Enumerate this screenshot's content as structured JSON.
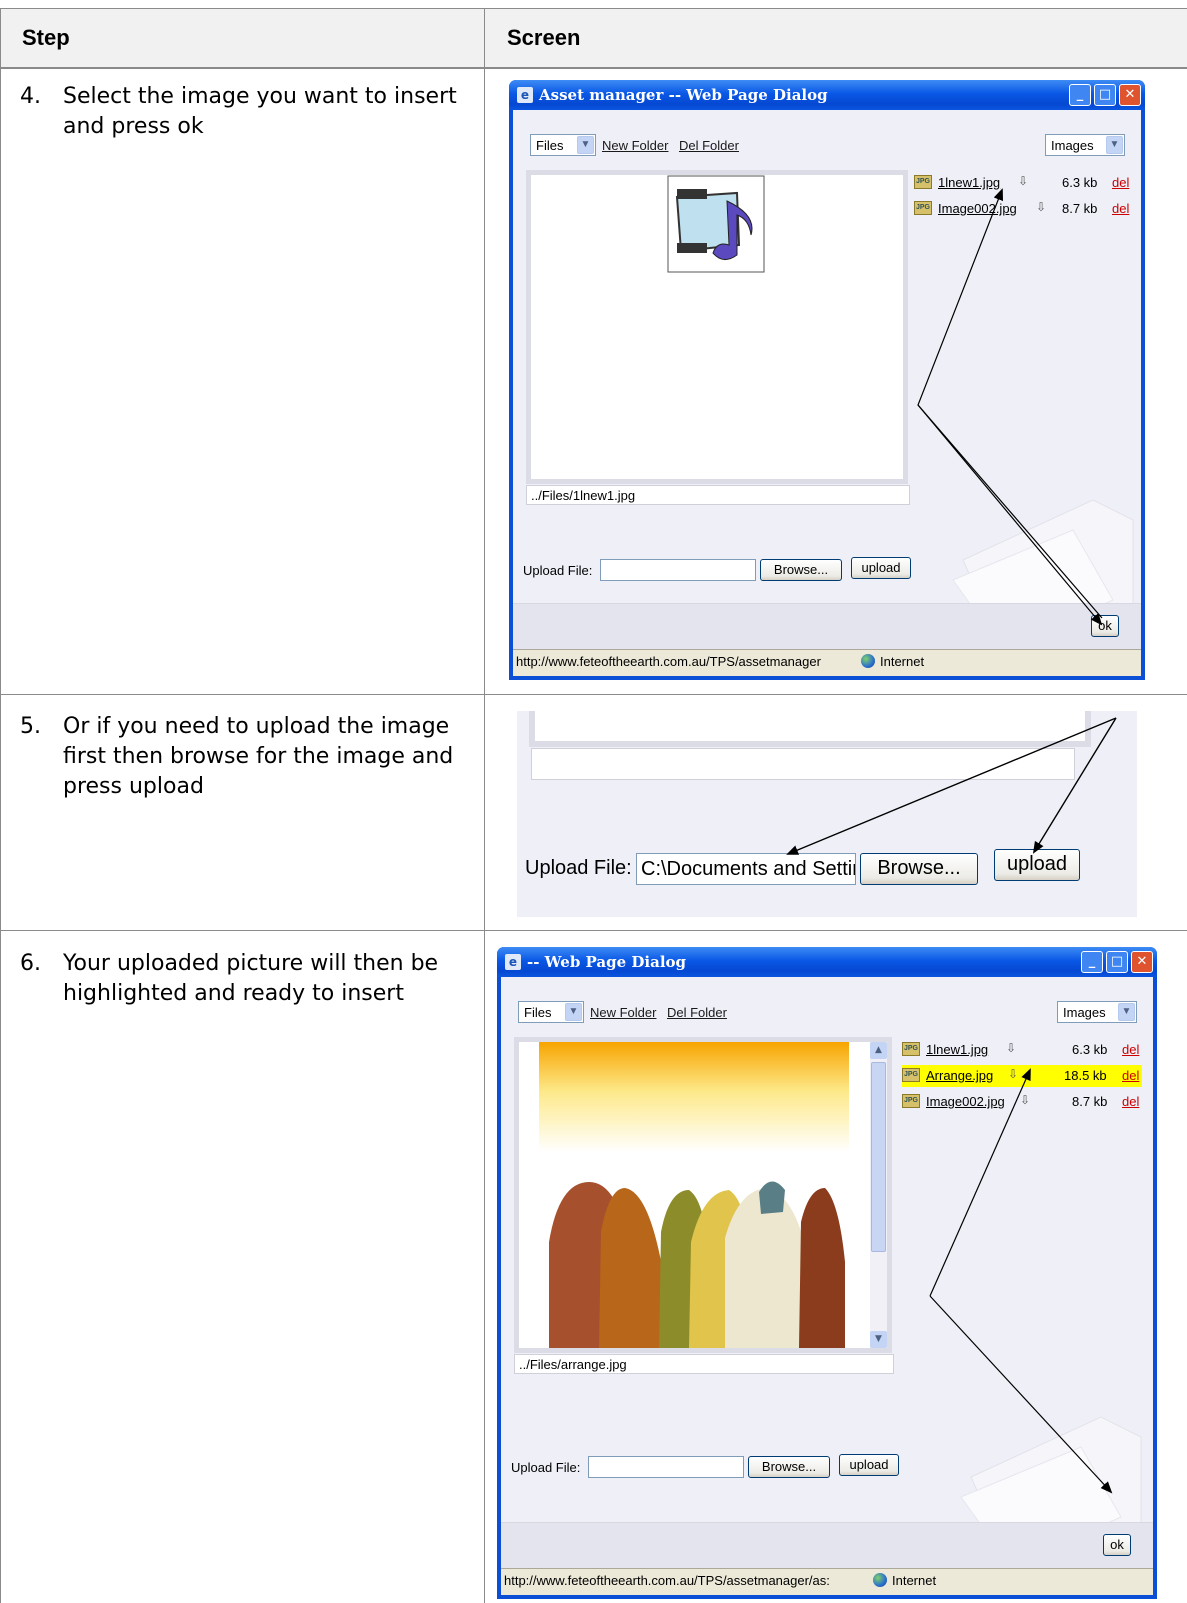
{
  "table": {
    "headers": {
      "step": "Step",
      "screen": "Screen"
    },
    "rows": [
      {
        "num": "4.",
        "text": "Select the image you want to insert and press ok"
      },
      {
        "num": "5.",
        "text": "Or if you need to upload the image first then browse for the image and press upload"
      },
      {
        "num": "6.",
        "text": "Your uploaded picture will then be highlighted and ready to insert"
      }
    ]
  },
  "dialog1": {
    "title": "Asset manager -- Web Page Dialog",
    "folder_select": "Files",
    "new_folder": "New Folder",
    "del_folder": "Del Folder",
    "type_select": "Images",
    "files": [
      {
        "name": "1lnew1.jpg",
        "size": "6.3 kb",
        "del": "del"
      },
      {
        "name": "Image002.jpg",
        "size": "8.7 kb",
        "del": "del"
      }
    ],
    "path": "../Files/1lnew1.jpg",
    "upload_label": "Upload File:",
    "browse": "Browse...",
    "upload": "upload",
    "ok": "ok",
    "status_url": "http://www.feteoftheearth.com.au/TPS/assetmanager",
    "status_zone": "Internet"
  },
  "snippet": {
    "upload_label": "Upload File:",
    "file_value": "C:\\Documents and Settir",
    "browse": "Browse...",
    "upload": "upload"
  },
  "dialog2": {
    "title": "-- Web Page Dialog",
    "folder_select": "Files",
    "new_folder": "New Folder",
    "del_folder": "Del Folder",
    "type_select": "Images",
    "files": [
      {
        "name": "1lnew1.jpg",
        "size": "6.3 kb",
        "del": "del"
      },
      {
        "name": "Arrange.jpg",
        "size": "18.5 kb",
        "del": "del"
      },
      {
        "name": "Image002.jpg",
        "size": "8.7 kb",
        "del": "del"
      }
    ],
    "path": "../Files/arrange.jpg",
    "upload_label": "Upload File:",
    "browse": "Browse...",
    "upload": "upload",
    "ok": "ok",
    "status_url": "http://www.feteoftheearth.com.au/TPS/assetmanager/as:",
    "status_zone": "Internet"
  },
  "colors": {
    "highlight": "#ffff00",
    "titlebar": "#0a58e6",
    "del_link": "#cc0000"
  },
  "icons": [
    "ie-icon",
    "minimize-icon",
    "maximize-icon",
    "close-icon",
    "jpg-file-icon",
    "download-icon",
    "globe-icon",
    "media-icon",
    "folder-watermark-icon"
  ]
}
